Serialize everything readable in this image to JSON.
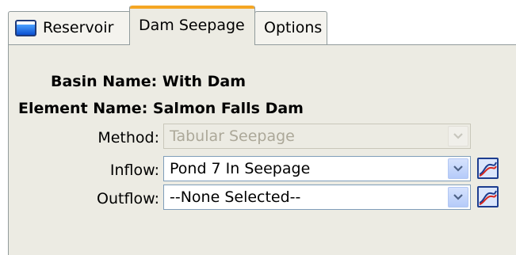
{
  "tabs": [
    {
      "label": "Reservoir",
      "icon": "reservoir-icon"
    },
    {
      "label": "Dam Seepage"
    },
    {
      "label": "Options"
    }
  ],
  "active_tab": "Dam Seepage",
  "basin": {
    "label": "Basin Name:",
    "value": "With Dam"
  },
  "element": {
    "label": "Element Name:",
    "value": "Salmon Falls Dam"
  },
  "method": {
    "label": "Method:",
    "value": "Tabular Seepage",
    "enabled": false
  },
  "inflow": {
    "label": "Inflow:",
    "value": "Pond 7 In Seepage"
  },
  "outflow": {
    "label": "Outflow:",
    "value": "--None Selected--"
  },
  "colors": {
    "active_tab_accent": "#f5a623",
    "panel_bg": "#ecebe3",
    "graph_curve": "#d7261e"
  }
}
